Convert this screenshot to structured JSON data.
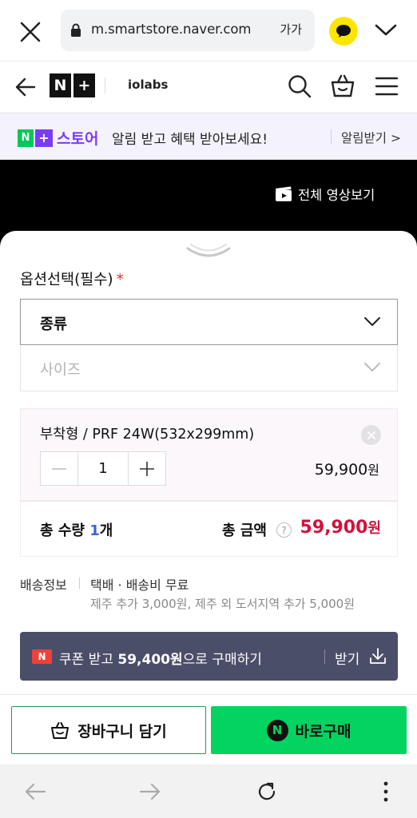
{
  "browser": {
    "url": "m.smartstore.naver.com",
    "font_size_label": "가가"
  },
  "header": {
    "logo_n": "N",
    "logo_plus": "+",
    "store_name": "iolabs"
  },
  "notify_banner": {
    "logo_n": "N",
    "logo_plus": "+",
    "logo_text": "스토어",
    "message": "알림 받고 혜택 받아보세요!",
    "link": "알림받기 >"
  },
  "video": {
    "label": "전체 영상보기"
  },
  "options": {
    "title": "옵션선택(필수)",
    "required_mark": "*",
    "dropdowns": [
      {
        "label": "종류"
      },
      {
        "label": "사이즈"
      }
    ]
  },
  "selected_item": {
    "name": "부착형 / PRF 24W(532x299mm)",
    "quantity": "1",
    "price": "59,900",
    "price_unit": "원"
  },
  "totals": {
    "qty_prefix": "총 수량 ",
    "qty_num": "1",
    "qty_suffix": "개",
    "amount_label": "총 금액",
    "help": "?",
    "amount": "59,900",
    "amount_unit": "원"
  },
  "shipping": {
    "label": "배송정보",
    "main": "택배 · 배송비 무료",
    "sub": "제주 추가 3,000원, 제주 외 도서지역 추가 5,000원"
  },
  "coupon": {
    "badge": "N",
    "text_prefix": "쿠폰 받고 ",
    "amount": "59,400원",
    "text_suffix": "으로 구매하기",
    "get_label": "받기"
  },
  "actions": {
    "cart_label": "장바구니 담기",
    "buy_badge": "N",
    "buy_label": "바로구매"
  },
  "colors": {
    "naver_green": "#03c75a",
    "buy_green": "#03d35f",
    "price_red": "#d1123b",
    "store_purple": "#7b3cf5",
    "coupon_bg": "#4b4e68"
  }
}
